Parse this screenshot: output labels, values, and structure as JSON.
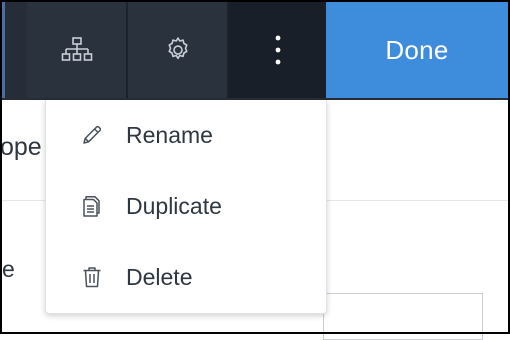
{
  "toolbar": {
    "structure_icon": "sitemap-icon",
    "settings_icon": "gear-icon",
    "more_icon": "vertical-dots-icon",
    "done_label": "Done"
  },
  "background": {
    "heading_fragment": "ope",
    "label_fragment": "e"
  },
  "menu": {
    "items": [
      {
        "label": "Rename",
        "icon": "pencil-icon"
      },
      {
        "label": "Duplicate",
        "icon": "copy-icon"
      },
      {
        "label": "Delete",
        "icon": "trash-icon"
      }
    ]
  },
  "colors": {
    "toolbar_bg": "#262d38",
    "active_button_bg": "#191f28",
    "done_bg": "#3e8ddd",
    "text": "#2f3740"
  }
}
